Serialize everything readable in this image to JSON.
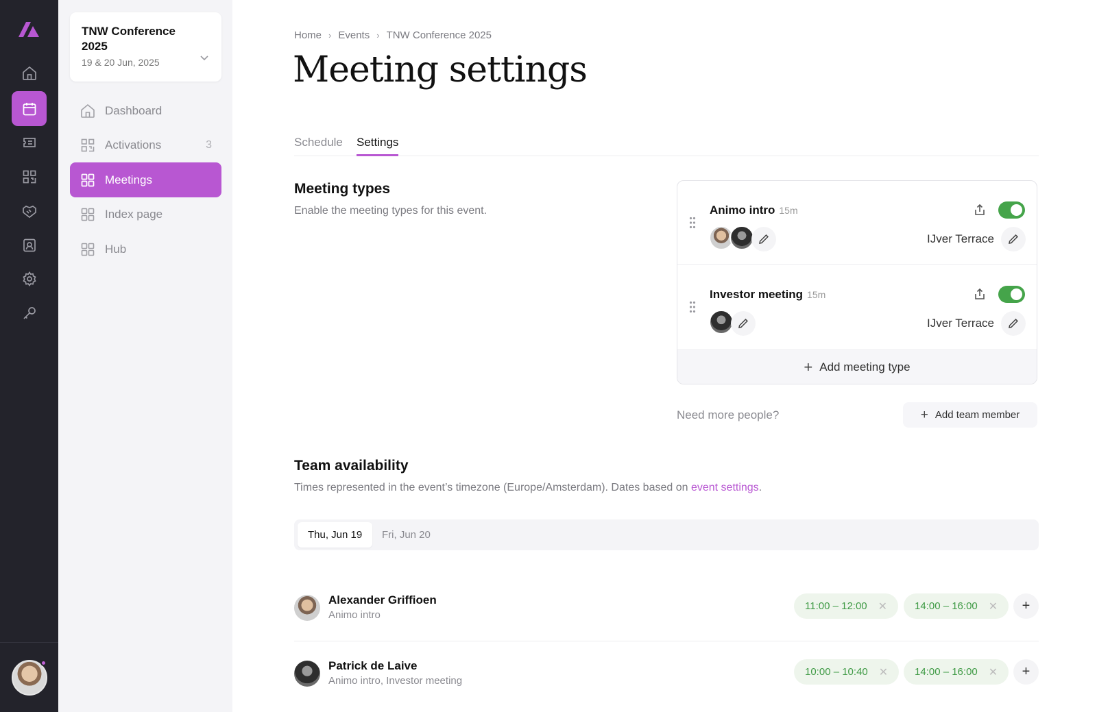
{
  "event": {
    "title": "TNW Conference 2025",
    "dates": "19 & 20 Jun, 2025"
  },
  "nav": {
    "items": [
      {
        "label": "Dashboard",
        "icon": "home-icon"
      },
      {
        "label": "Activations",
        "icon": "qr-icon",
        "count": "3"
      },
      {
        "label": "Meetings",
        "icon": "grid-icon",
        "active": true
      },
      {
        "label": "Index page",
        "icon": "grid-icon"
      },
      {
        "label": "Hub",
        "icon": "grid-icon"
      }
    ]
  },
  "breadcrumb": [
    "Home",
    "Events",
    "TNW Conference 2025"
  ],
  "page": {
    "title": "Meeting settings"
  },
  "tabs": [
    "Schedule",
    "Settings"
  ],
  "meeting_types": {
    "title": "Meeting types",
    "subtitle": "Enable the meeting types for this event.",
    "items": [
      {
        "name": "Animo intro",
        "duration": "15m",
        "location": "IJver Terrace",
        "enabled": true
      },
      {
        "name": "Investor meeting",
        "duration": "15m",
        "location": "IJver Terrace",
        "enabled": true
      }
    ],
    "add_label": "Add meeting type",
    "need_more": "Need more people?",
    "add_member_label": "Add team member"
  },
  "team": {
    "title": "Team availability",
    "subtitle_prefix": "Times represented in the event’s timezone (Europe/Amsterdam). Dates based on ",
    "subtitle_link": "event settings",
    "subtitle_suffix": ".",
    "days": [
      "Thu, Jun 19",
      "Fri, Jun 20"
    ],
    "people": [
      {
        "name": "Alexander Griffioen",
        "role": "Animo intro",
        "slots": [
          "11:00 – 12:00",
          "14:00 – 16:00"
        ]
      },
      {
        "name": "Patrick de Laive",
        "role": "Animo intro, Investor meeting",
        "slots": [
          "10:00 – 10:40",
          "14:00 – 16:00"
        ]
      }
    ]
  },
  "colors": {
    "accent": "#b857d2",
    "rail": "#23232b",
    "toggle_on": "#45a44a",
    "slot_text": "#3f9a45",
    "slot_bg": "#eef5ec"
  }
}
